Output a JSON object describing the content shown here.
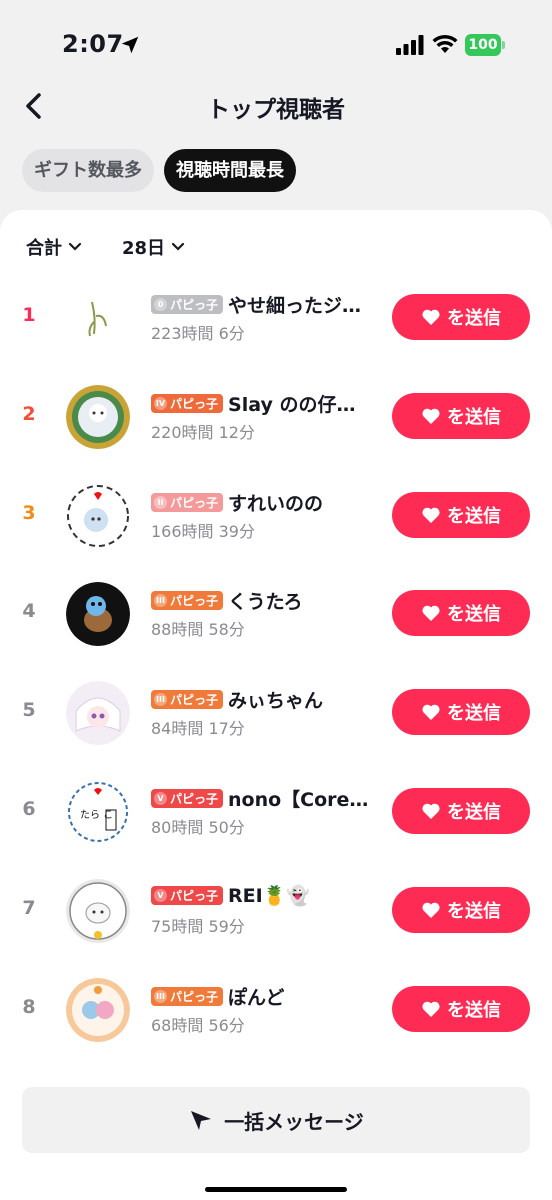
{
  "status_bar": {
    "time": "2:07",
    "battery": "100"
  },
  "header": {
    "title": "トップ視聴者",
    "back_icon": "chevron-left-icon"
  },
  "tabs": [
    {
      "label": "ギフト数最多",
      "active": false
    },
    {
      "label": "視聴時間最長",
      "active": true
    }
  ],
  "filters": {
    "scope": "合計",
    "period": "28日"
  },
  "send_label": "を送信",
  "rank_colors": {
    "1": "#fe2c55",
    "2": "#f24e39",
    "3": "#f28a1e",
    "default": "#8a8b91"
  },
  "viewers": [
    {
      "rank": "1",
      "badge_level": "0",
      "badge_label": "パピっ子",
      "badge_color": "#bdbec2",
      "name": "やせ細ったジ…",
      "watch_time": "223時間 6分"
    },
    {
      "rank": "2",
      "badge_level": "IV",
      "badge_label": "パピっ子",
      "badge_color": "#ef6a3a",
      "name": "Slay のの仔…",
      "watch_time": "220時間 12分"
    },
    {
      "rank": "3",
      "badge_level": "II",
      "badge_label": "パピっ子",
      "badge_color": "#f59a9a",
      "name": "すれいのの",
      "watch_time": "166時間 39分"
    },
    {
      "rank": "4",
      "badge_level": "III",
      "badge_label": "パピっ子",
      "badge_color": "#ef7a3a",
      "name": "くうたろ",
      "watch_time": "88時間 58分"
    },
    {
      "rank": "5",
      "badge_level": "III",
      "badge_label": "パピっ子",
      "badge_color": "#ef7a3a",
      "name": "みぃちゃん",
      "watch_time": "84時間 17分"
    },
    {
      "rank": "6",
      "badge_level": "V",
      "badge_label": "パピっ子",
      "badge_color": "#ee4848",
      "name": "nono【Core…",
      "watch_time": "80時間 50分"
    },
    {
      "rank": "7",
      "badge_level": "V",
      "badge_label": "パピっ子",
      "badge_color": "#ee4848",
      "name": "REI🍍👻",
      "watch_time": "75時間 59分"
    },
    {
      "rank": "8",
      "badge_level": "III",
      "badge_label": "パピっ子",
      "badge_color": "#ef7a3a",
      "name": "ぽんど",
      "watch_time": "68時間 56分"
    }
  ],
  "bottom": {
    "label": "一括メッセージ"
  }
}
